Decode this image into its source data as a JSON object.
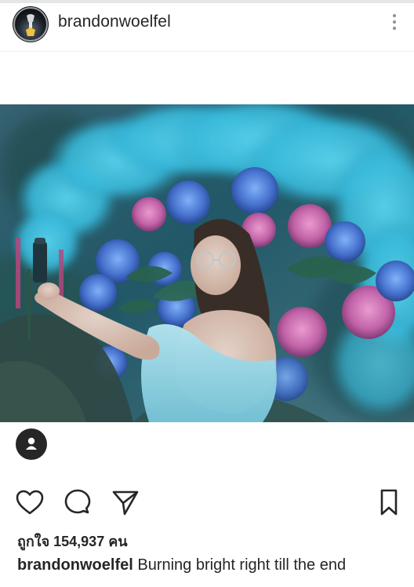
{
  "post": {
    "username": "brandonwoelfel",
    "more_icon": "more-vertical-icon",
    "photo_subject": "",
    "tag_icon": "person-icon",
    "likes_text": "ถูกใจ 154,937 คน",
    "caption_username": "brandonwoelfel",
    "caption_text": " Burning bright right till the end"
  },
  "actions": {
    "like_icon": "heart-icon",
    "comment_icon": "comment-icon",
    "share_icon": "send-icon",
    "save_icon": "bookmark-icon"
  },
  "colors": {
    "text": "#262626",
    "icon": "#262626",
    "smoke": "#3ec7e6",
    "divider": "#efefef"
  }
}
